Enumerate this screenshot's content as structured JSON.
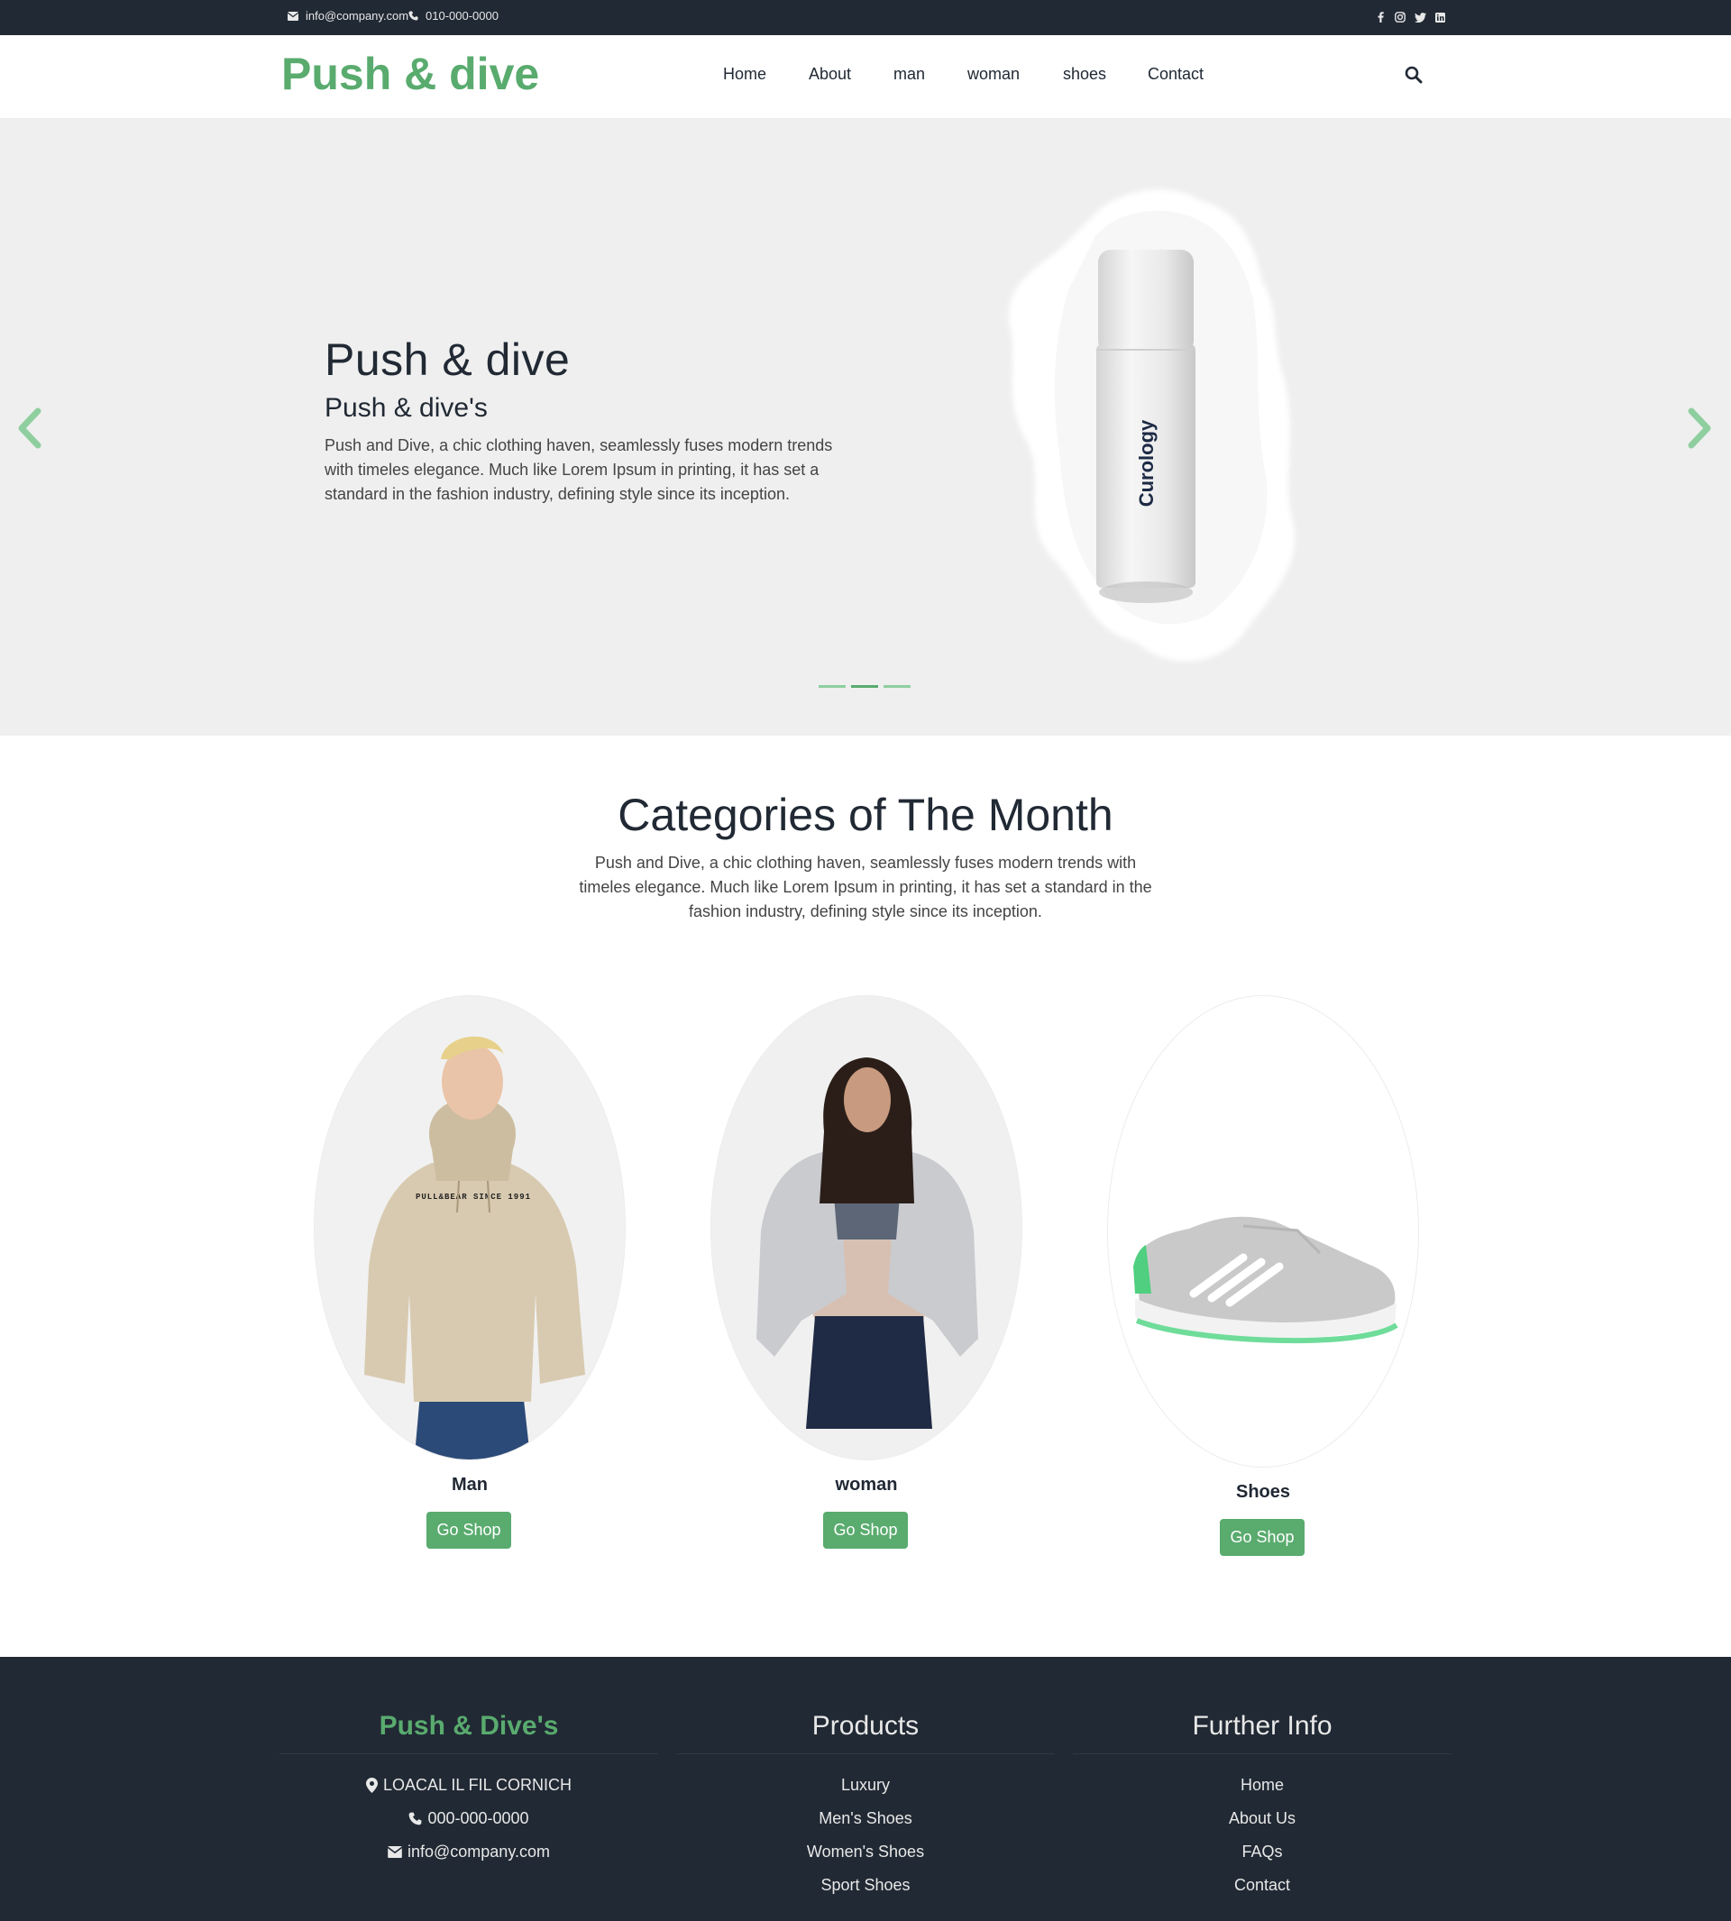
{
  "topbar": {
    "email": "info@company.com",
    "phone": "010-000-0000",
    "social_icons": [
      "facebook-icon",
      "instagram-icon",
      "twitter-icon",
      "linkedin-icon"
    ]
  },
  "nav": {
    "logo": "Push & dive",
    "links": [
      "Home",
      "About",
      "man",
      "woman",
      "shoes",
      "Contact"
    ],
    "search_icon": "search-icon"
  },
  "hero": {
    "title": "Push & dive",
    "subtitle": "Push & dive's",
    "description": "Push and Dive, a chic clothing haven, seamlessly fuses modern trends with timeles elegance. Much like Lorem Ipsum in printing, it has set a standard in the fashion industry, defining style since its inception.",
    "product_label": "Curology",
    "slides_total": 3,
    "active_slide": 2
  },
  "categories": {
    "title": "Categories of The Month",
    "description": "Push and Dive, a chic clothing haven, seamlessly fuses modern trends with timeles elegance. Much like Lorem Ipsum in printing, it has set a standard in the fashion industry, defining style since its inception.",
    "items": [
      {
        "name": "Man",
        "button": "Go Shop",
        "hoodie_text": "PULL&BEAR SINCE 1991"
      },
      {
        "name": "woman",
        "button": "Go Shop"
      },
      {
        "name": "Shoes",
        "button": "Go Shop"
      }
    ]
  },
  "footer": {
    "brand": {
      "title": "Push & Dive's",
      "address": "LOACAL IL FIL CORNICH",
      "phone": "000-000-0000",
      "email": "info@company.com"
    },
    "products": {
      "title": "Products",
      "items": [
        "Luxury",
        "Men's Shoes",
        "Women's Shoes",
        "Sport Shoes"
      ]
    },
    "info": {
      "title": "Further Info",
      "items": [
        "Home",
        "About Us",
        "FAQs",
        "Contact"
      ]
    }
  },
  "colors": {
    "accent": "#59ab6e",
    "dark": "#212934",
    "hero_bg": "#efefef"
  }
}
